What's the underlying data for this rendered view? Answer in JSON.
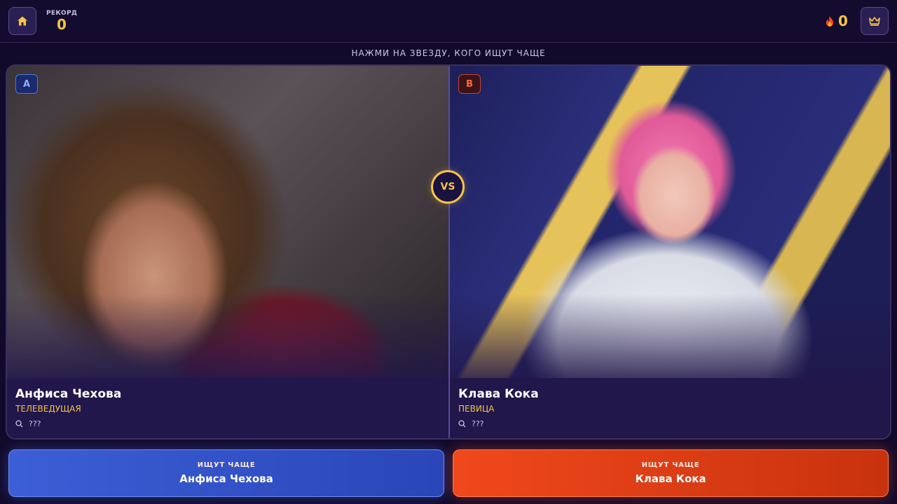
{
  "header": {
    "home_icon": "home-icon",
    "record_label": "РЕКОРД",
    "record_value": "0",
    "streak_icon": "flame-icon",
    "streak_value": "0",
    "crown_icon": "crown-icon"
  },
  "instruction": "НАЖМИ НА ЗВЕЗДУ, КОГО ИЩУТ ЧАЩЕ",
  "vs_label": "VS",
  "cards": {
    "a": {
      "badge": "A",
      "name": "Анфиса Чехова",
      "profession": "ТЕЛЕВЕДУЩАЯ",
      "searches": "???"
    },
    "b": {
      "badge": "B",
      "name": "Клава Кока",
      "profession": "ПЕВИЦА",
      "searches": "???"
    }
  },
  "answers": {
    "a": {
      "caption": "ИЩУТ ЧАЩЕ",
      "name": "Анфиса Чехова"
    },
    "b": {
      "caption": "ИЩУТ ЧАЩЕ",
      "name": "Клава Кока"
    }
  },
  "colors": {
    "accent_gold": "#f6c447",
    "option_a": "#3c5ed6",
    "option_b": "#f0481c",
    "background": "#120a2a"
  }
}
